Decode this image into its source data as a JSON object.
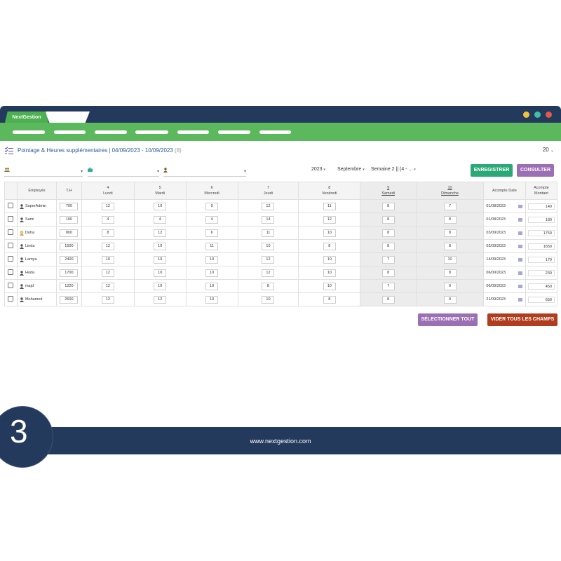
{
  "app": {
    "tab_label": "NextGestion",
    "colors": {
      "navy": "#243a5c",
      "green": "#5cb85c",
      "dot_yellow": "#f0c23c",
      "dot_teal": "#3cc3a5",
      "dot_red": "#e05a4a"
    }
  },
  "header": {
    "title": "Pointage & Heures supplémentaires | 04/09/2023 - 10/09/2023",
    "count": "(8)",
    "page_size": "20"
  },
  "filters": {
    "year": "2023",
    "month": "Septembre",
    "week": "Semaine 2 || (4 - ..."
  },
  "buttons": {
    "save": "ENREGISTRER",
    "consult": "CONSULTER",
    "select_all": "SÉLECTIONNER TOUT",
    "clear_all": "VIDER TOUS LES CHAMPS"
  },
  "table": {
    "headers": {
      "employee": "Employés",
      "th": "T.H",
      "days": [
        {
          "num": "4",
          "name": "Lundi"
        },
        {
          "num": "5",
          "name": "Mardi"
        },
        {
          "num": "6",
          "name": "Mercredi"
        },
        {
          "num": "7",
          "name": "Jeudi"
        },
        {
          "num": "8",
          "name": "Vendredi"
        },
        {
          "num": "9",
          "name": "Samedi"
        },
        {
          "num": "10",
          "name": "Dimanche"
        }
      ],
      "advance_date": "Acompte Date",
      "advance_amount_1": "Acompte",
      "advance_amount_2": "Montant"
    },
    "rows": [
      {
        "name": "SuperAdmin",
        "th": "700",
        "hours": [
          "12",
          "10",
          "9",
          "12",
          "11",
          "8",
          "7"
        ],
        "date": "01/08/2023",
        "amount": "140",
        "avatar": "male"
      },
      {
        "name": "Sami",
        "th": "100",
        "hours": [
          "4",
          "4",
          "4",
          "14",
          "12",
          "8",
          "8"
        ],
        "date": "01/08/2023",
        "amount": "180",
        "avatar": "male"
      },
      {
        "name": "Doha",
        "th": "800",
        "hours": [
          "8",
          "12",
          "6",
          "11",
          "10",
          "8",
          "8"
        ],
        "date": "03/09/2023",
        "amount": "1750",
        "avatar": "female"
      },
      {
        "name": "Linda",
        "th": "1500",
        "hours": [
          "12",
          "10",
          "11",
          "10",
          "8",
          "8",
          "8"
        ],
        "date": "02/09/2023",
        "amount": "1650",
        "avatar": "male"
      },
      {
        "name": "Lamya",
        "th": "2400",
        "hours": [
          "10",
          "10",
          "10",
          "12",
          "10",
          "7",
          "10"
        ],
        "date": "14/09/2023",
        "amount": "170",
        "avatar": "male"
      },
      {
        "name": "Hoda",
        "th": "1700",
        "hours": [
          "12",
          "10",
          "10",
          "12",
          "10",
          "8",
          "8"
        ],
        "date": "06/09/2023",
        "amount": "230",
        "avatar": "male"
      },
      {
        "name": "majd",
        "th": "1220",
        "hours": [
          "12",
          "10",
          "10",
          "8",
          "10",
          "7",
          "9"
        ],
        "date": "06/09/2023",
        "amount": "450",
        "avatar": "male"
      },
      {
        "name": "Mohamed",
        "th": "2600",
        "hours": [
          "12",
          "12",
          "10",
          "10",
          "8",
          "8",
          "9"
        ],
        "date": "21/09/2023",
        "amount": "650",
        "avatar": "male"
      }
    ]
  },
  "footer": {
    "url": "www.nextgestion.com"
  },
  "badge": {
    "number": "3"
  }
}
